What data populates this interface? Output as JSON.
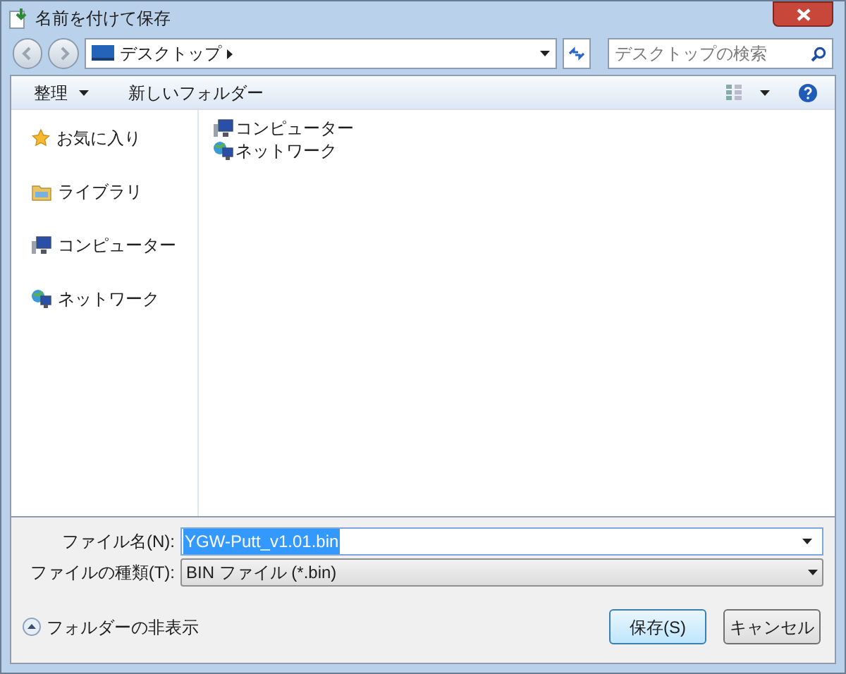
{
  "window": {
    "title": "名前を付けて保存"
  },
  "address": {
    "location": "デスクトップ",
    "search_placeholder": "デスクトップの検索"
  },
  "toolbar": {
    "organize": "整理",
    "new_folder": "新しいフォルダー"
  },
  "sidebar": {
    "items": [
      {
        "kind": "favorites",
        "label": "お気に入り"
      },
      {
        "kind": "library",
        "label": "ライブラリ"
      },
      {
        "kind": "computer",
        "label": "コンピューター"
      },
      {
        "kind": "network",
        "label": "ネットワーク"
      }
    ]
  },
  "files": [
    {
      "kind": "computer",
      "name": "コンピューター"
    },
    {
      "kind": "network",
      "name": "ネットワーク"
    }
  ],
  "form": {
    "filename_label": "ファイル名(N):",
    "filename": "YGW-Putt_v1.01.bin",
    "type_label": "ファイルの種類(T):",
    "type": "BIN ファイル (*.bin)"
  },
  "footer": {
    "hide_folders": "フォルダーの非表示",
    "save": "保存(S)",
    "cancel": "キャンセル"
  }
}
